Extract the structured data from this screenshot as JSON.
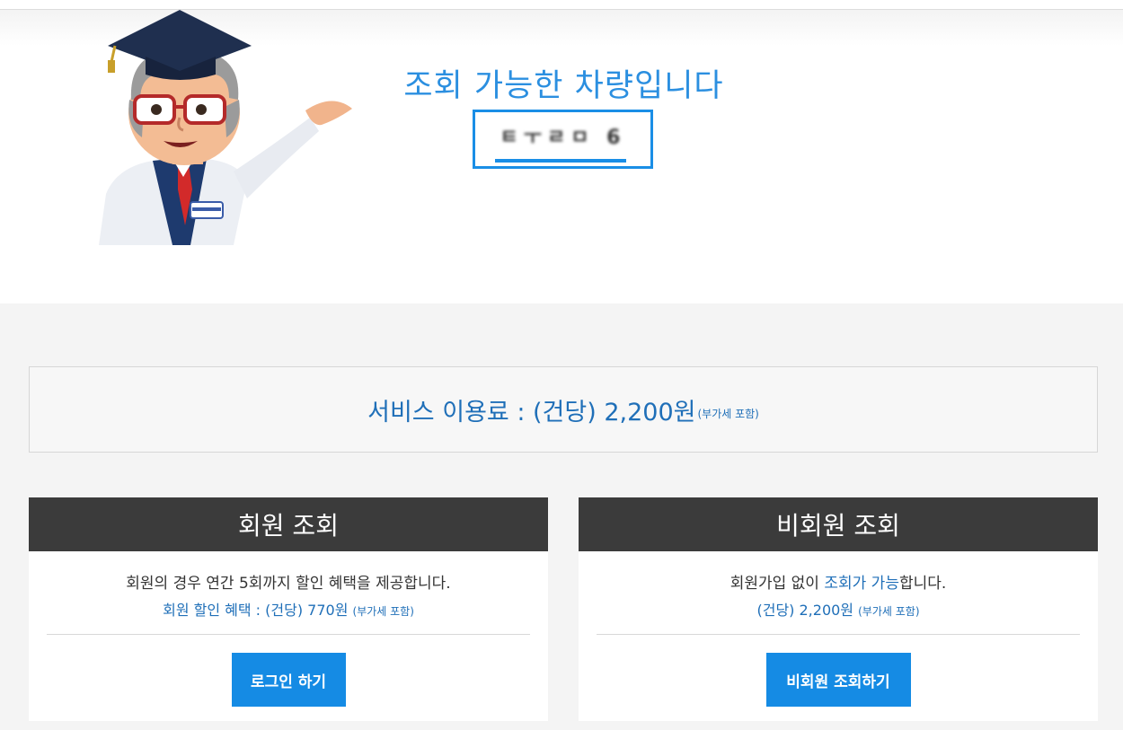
{
  "hero": {
    "title": "조회 가능한 차량입니다",
    "plate": "ㅌㅜㄹㅁ 6"
  },
  "fee": {
    "main": "서비스 이용료 : (건당) 2,200원",
    "note": "(부가세 포함)"
  },
  "member": {
    "title": "회원 조회",
    "desc": "회원의 경우 연간 5회까지 할인 혜택을 제공합니다.",
    "price": "회원 할인 혜택 : (건당) 770원",
    "price_note": "(부가세 포함)",
    "button": "로그인 하기"
  },
  "guest": {
    "title": "비회원 조회",
    "desc_a": "회원가입 없이 ",
    "desc_b": "조회가 가능",
    "desc_c": "합니다.",
    "price": "(건당) 2,200원",
    "price_note": "(부가세 포함)",
    "button": "비회원 조회하기"
  },
  "colors": {
    "accent": "#158be4",
    "accent_text": "#1f6fb8",
    "header_bg": "#3b3b3b"
  },
  "icons": {
    "mascot": "professor-mascot-icon"
  }
}
